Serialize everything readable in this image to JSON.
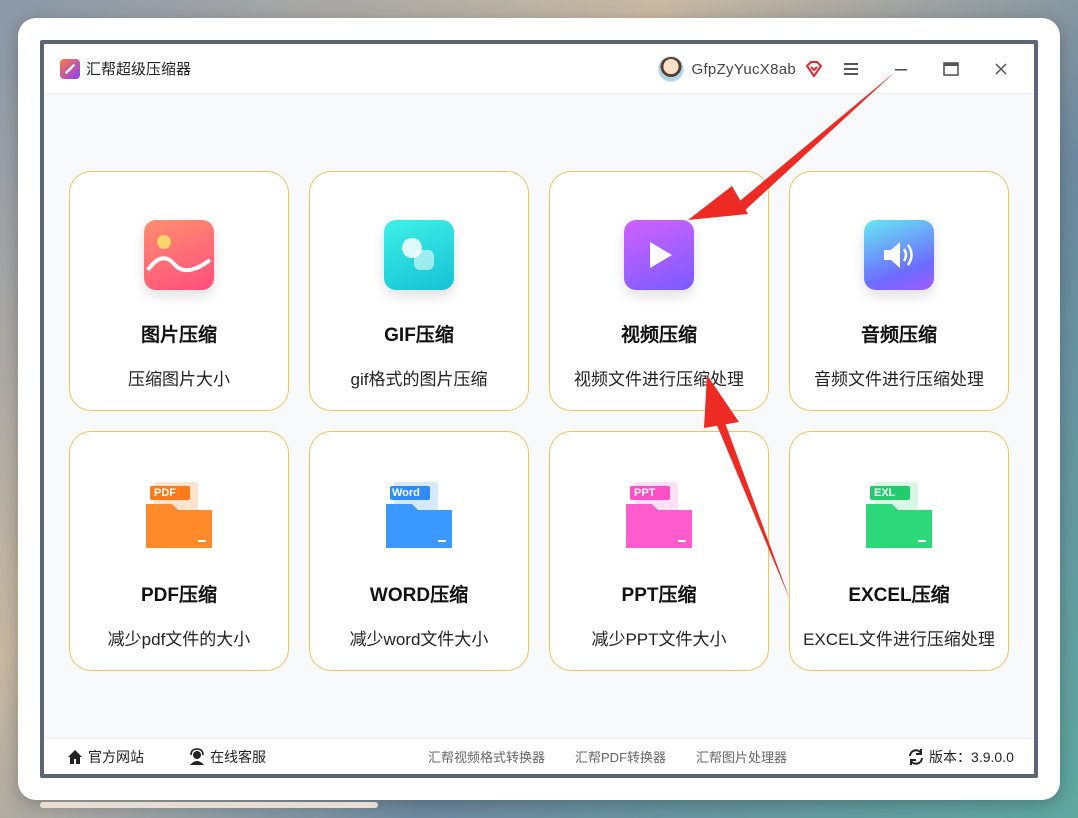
{
  "titlebar": {
    "app_title": "汇帮超级压缩器",
    "username": "GfpZyYucX8ab"
  },
  "tiles": [
    {
      "title": "图片压缩",
      "subtitle": "压缩图片大小",
      "icon": "image-icon"
    },
    {
      "title": "GIF压缩",
      "subtitle": "gif格式的图片压缩",
      "icon": "gif-icon"
    },
    {
      "title": "视频压缩",
      "subtitle": "视频文件进行压缩处理",
      "icon": "video-play-icon"
    },
    {
      "title": "音频压缩",
      "subtitle": "音频文件进行压缩处理",
      "icon": "speaker-icon"
    },
    {
      "title": "PDF压缩",
      "subtitle": "减少pdf文件的大小",
      "icon": "pdf-folder-icon",
      "badge": "PDF"
    },
    {
      "title": "WORD压缩",
      "subtitle": "减少word文件大小",
      "icon": "word-folder-icon",
      "badge": "Word"
    },
    {
      "title": "PPT压缩",
      "subtitle": "减少PPT文件大小",
      "icon": "ppt-folder-icon",
      "badge": "PPT"
    },
    {
      "title": "EXCEL压缩",
      "subtitle": "EXCEL文件进行压缩处理",
      "icon": "excel-folder-icon",
      "badge": "EXL"
    }
  ],
  "footer": {
    "website": "官方网站",
    "support": "在线客服",
    "links": [
      "汇帮视频格式转换器",
      "汇帮PDF转换器",
      "汇帮图片处理器"
    ],
    "version_label": "版本：3.9.0.0"
  },
  "colors": {
    "tile_border": "#f2c35b",
    "annotation_arrow": "#ee2a24",
    "pdf": "#ff7a1a",
    "word": "#2f8cff",
    "ppt": "#ff4fc8",
    "excel": "#22cc6e"
  }
}
